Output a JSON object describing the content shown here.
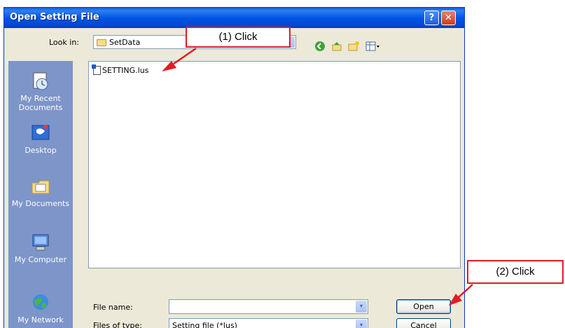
{
  "dialog": {
    "title": "Open Setting File",
    "help_glyph": "?",
    "close_glyph": "✕",
    "look_in_label": "Look in:",
    "look_in_value": "SetData",
    "places": [
      {
        "label": "My Recent Documents",
        "icon": "recent-documents-icon"
      },
      {
        "label": "Desktop",
        "icon": "desktop-icon"
      },
      {
        "label": "My Documents",
        "icon": "my-documents-icon"
      },
      {
        "label": "My Computer",
        "icon": "my-computer-icon"
      },
      {
        "label": "My Network",
        "icon": "my-network-icon"
      }
    ],
    "files": [
      {
        "name": "SETTING.lus"
      }
    ],
    "file_name_label": "File name:",
    "file_name_value": "",
    "file_type_label": "Files of type:",
    "file_type_value": "Setting file (*lus)",
    "open_label": "Open",
    "cancel_label": "Cancel",
    "arrow_glyph": "▾"
  },
  "annotations": {
    "click1": "(1) Click",
    "click2": "(2) Click",
    "color": "#e31b23"
  }
}
